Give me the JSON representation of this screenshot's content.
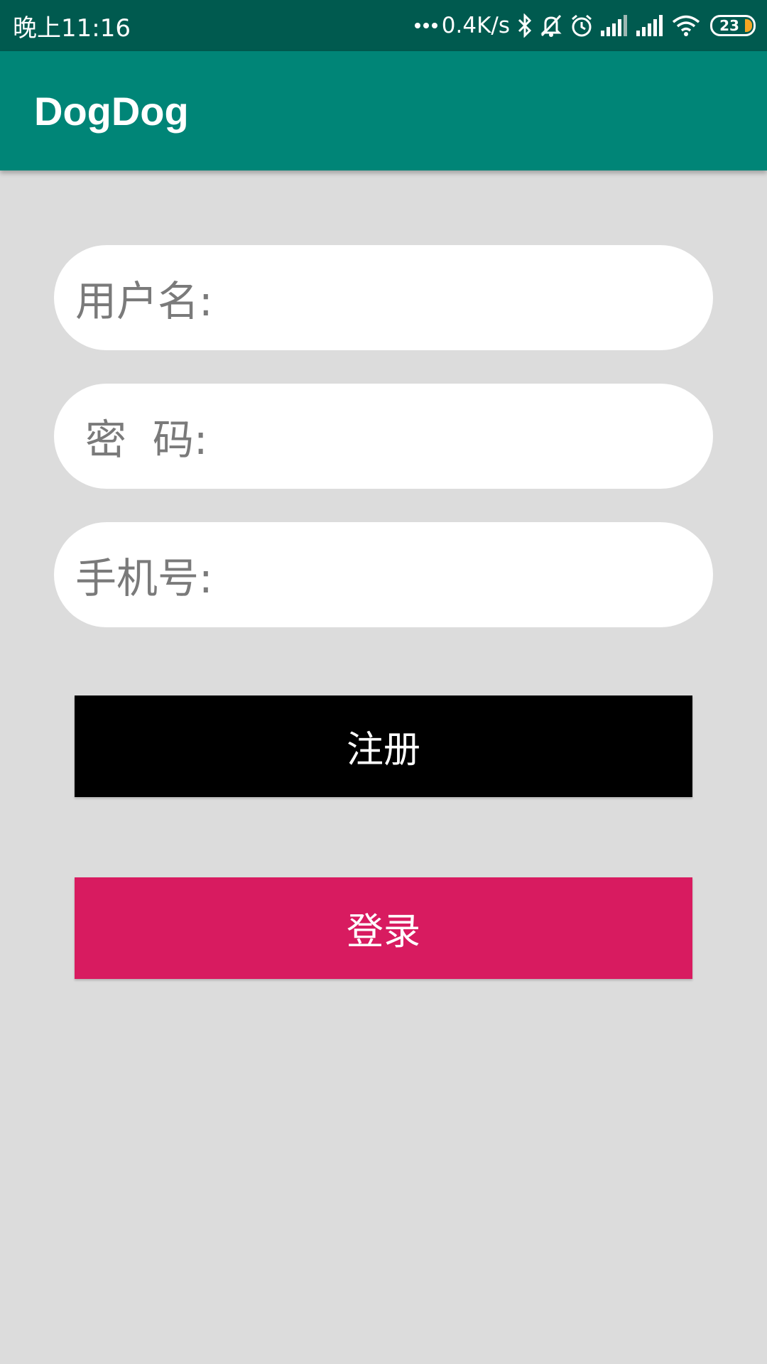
{
  "status_bar": {
    "time": "晚上11:16",
    "net_speed": "0.4K/s",
    "battery_level": "23",
    "battery_fill_color": "#f5a623",
    "icons": [
      "bluetooth-icon",
      "bell-off-icon",
      "alarm-icon",
      "signal-icon",
      "signal-icon",
      "wifi-icon",
      "battery-icon"
    ]
  },
  "app_bar": {
    "title": "DogDog",
    "background": "#008577"
  },
  "form": {
    "username_label": "用户名:",
    "username_value": "",
    "password_label": "密  码:",
    "password_value": "",
    "phone_label": "手机号:",
    "phone_value": ""
  },
  "buttons": {
    "register_label": "注册",
    "login_label": "登录"
  },
  "colors": {
    "accent": "#d81b60",
    "primary_dark": "#005a4f",
    "background": "#dcdcdc"
  }
}
